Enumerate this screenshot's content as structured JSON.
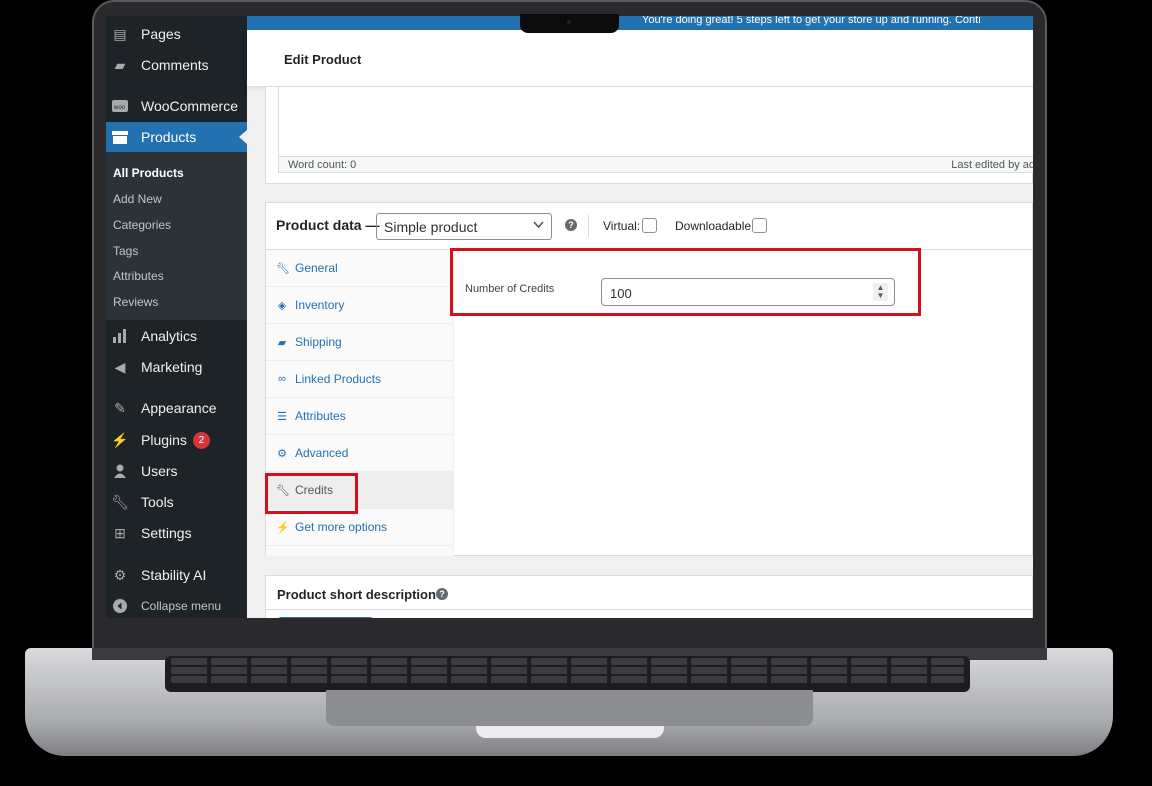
{
  "sidebar": {
    "items": [
      {
        "label": "Pages",
        "icon": "pages-icon"
      },
      {
        "label": "Comments",
        "icon": "comments-icon"
      },
      {
        "label": "WooCommerce",
        "icon": "woocommerce-icon"
      },
      {
        "label": "Products",
        "icon": "products-icon"
      },
      {
        "label": "Analytics",
        "icon": "analytics-icon"
      },
      {
        "label": "Marketing",
        "icon": "marketing-icon"
      },
      {
        "label": "Appearance",
        "icon": "appearance-icon"
      },
      {
        "label": "Plugins",
        "icon": "plugins-icon",
        "badge": "2"
      },
      {
        "label": "Users",
        "icon": "users-icon"
      },
      {
        "label": "Tools",
        "icon": "tools-icon"
      },
      {
        "label": "Settings",
        "icon": "settings-icon"
      },
      {
        "label": "Stability AI",
        "icon": "gear-icon"
      }
    ],
    "products_submenu": [
      "All Products",
      "Add New",
      "Categories",
      "Tags",
      "Attributes",
      "Reviews"
    ],
    "collapse_label": "Collapse menu"
  },
  "notice": {
    "text": "You're doing great! 5 steps left to get your store up and running. Conti"
  },
  "header": {
    "title": "Edit Product"
  },
  "editor": {
    "word_count": "Word count: 0",
    "last_edited": "Last edited by ad"
  },
  "product_data": {
    "title": "Product data —",
    "type_selected": "Simple product",
    "virtual_label": "Virtual:",
    "downloadable_label": "Downloadable:",
    "tabs": [
      {
        "label": "General",
        "icon": "wrench-icon"
      },
      {
        "label": "Inventory",
        "icon": "tag-icon"
      },
      {
        "label": "Shipping",
        "icon": "truck-icon"
      },
      {
        "label": "Linked Products",
        "icon": "link-icon"
      },
      {
        "label": "Attributes",
        "icon": "list-icon"
      },
      {
        "label": "Advanced",
        "icon": "gear-icon"
      },
      {
        "label": "Credits",
        "icon": "wrench-icon"
      },
      {
        "label": "Get more options",
        "icon": "plug-icon"
      }
    ],
    "credits_field": {
      "label": "Number of Credits",
      "value": "100"
    }
  },
  "short_description": {
    "title": "Product short description"
  },
  "colors": {
    "admin_blue": "#2271b1",
    "sidebar_dark": "#1d2327",
    "highlight_red": "#d50f1c"
  }
}
